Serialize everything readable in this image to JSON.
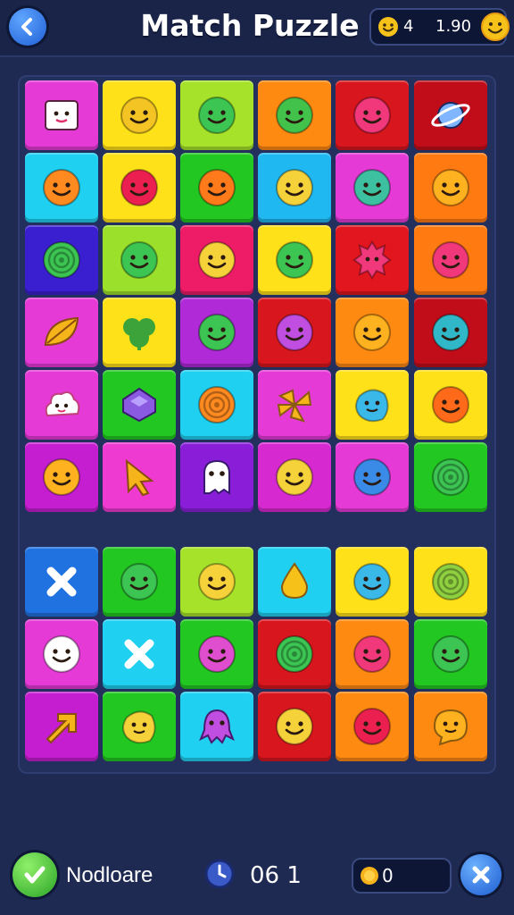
{
  "header": {
    "title": "Match Puzzle",
    "moves": "4",
    "score": "1.90"
  },
  "footer": {
    "label": "Nodloare",
    "timer": "06 1",
    "coins": "0"
  },
  "board": {
    "top_rows": [
      [
        {
          "bg": "#e53ad6",
          "icon": "square-face-icon",
          "fg": "#ffffff"
        },
        {
          "bg": "#ffe11a",
          "icon": "smiley-face-icon",
          "fg": "#f4c424"
        },
        {
          "bg": "#a6e22a",
          "icon": "smiley-face-icon",
          "fg": "#3cc552"
        },
        {
          "bg": "#ff8a12",
          "icon": "smiley-face-icon",
          "fg": "#42c24a"
        },
        {
          "bg": "#d8161e",
          "icon": "smiley-face-icon",
          "fg": "#f0387a"
        },
        {
          "bg": "#c10d1a",
          "icon": "planet-icon",
          "fg": "#7fb6ff"
        }
      ],
      [
        {
          "bg": "#1fd0f0",
          "icon": "smiley-face-icon",
          "fg": "#ff8a1f"
        },
        {
          "bg": "#ffe11a",
          "icon": "smiley-face-icon",
          "fg": "#ec2050"
        },
        {
          "bg": "#22c722",
          "icon": "smiley-face-icon",
          "fg": "#ff7a1a"
        },
        {
          "bg": "#1fb8f0",
          "icon": "smiley-face-icon",
          "fg": "#f6d23a"
        },
        {
          "bg": "#e53ad6",
          "icon": "smiley-face-icon",
          "fg": "#3cc0a0"
        },
        {
          "bg": "#ff7a10",
          "icon": "smiley-face-icon",
          "fg": "#ffb21f"
        }
      ],
      [
        {
          "bg": "#3a1fd0",
          "icon": "spiral-icon",
          "fg": "#3cc552"
        },
        {
          "bg": "#9be02a",
          "icon": "smiley-face-icon",
          "fg": "#3cc552"
        },
        {
          "bg": "#ee1c66",
          "icon": "smiley-face-icon",
          "fg": "#f6d23a"
        },
        {
          "bg": "#ffe11a",
          "icon": "smiley-face-icon",
          "fg": "#3cc552"
        },
        {
          "bg": "#e1161e",
          "icon": "spiky-monster-icon",
          "fg": "#f0387a"
        },
        {
          "bg": "#ff7a10",
          "icon": "smiley-face-icon",
          "fg": "#f0387a"
        }
      ],
      [
        {
          "bg": "#e53ad6",
          "icon": "leaf-icon",
          "fg": "#f4b41a"
        },
        {
          "bg": "#ffe11a",
          "icon": "clover-icon",
          "fg": "#3ca23a"
        },
        {
          "bg": "#b02ad8",
          "icon": "smiley-face-icon",
          "fg": "#3cc552"
        },
        {
          "bg": "#d8161e",
          "icon": "smiley-face-icon",
          "fg": "#c04ee0"
        },
        {
          "bg": "#ff8a12",
          "icon": "smiley-face-icon",
          "fg": "#ffb21f"
        },
        {
          "bg": "#c10d1a",
          "icon": "smiley-face-icon",
          "fg": "#30b8c8"
        }
      ],
      [
        {
          "bg": "#e53ad6",
          "icon": "cloud-face-icon",
          "fg": "#ffffff"
        },
        {
          "bg": "#22c722",
          "icon": "gem-icon",
          "fg": "#8a5ae0"
        },
        {
          "bg": "#1fd0f0",
          "icon": "spiral-icon",
          "fg": "#ff8a1f"
        },
        {
          "bg": "#e53ad6",
          "icon": "pinwheel-icon",
          "fg": "#f4b41a"
        },
        {
          "bg": "#ffe11a",
          "icon": "blob-face-icon",
          "fg": "#3ab8e8"
        },
        {
          "bg": "#ffe11a",
          "icon": "smiley-face-icon",
          "fg": "#ff6a1a"
        }
      ],
      [
        {
          "bg": "#c41ed0",
          "icon": "smiley-face-icon",
          "fg": "#ffb21f"
        },
        {
          "bg": "#ee3ad0",
          "icon": "cursor-arrow-icon",
          "fg": "#f4b41a"
        },
        {
          "bg": "#8a1ed8",
          "icon": "ghost-icon",
          "fg": "#ffffff"
        },
        {
          "bg": "#d62ad0",
          "icon": "smiley-face-icon",
          "fg": "#f6d23a"
        },
        {
          "bg": "#e53ad6",
          "icon": "smiley-face-icon",
          "fg": "#3a8ae8"
        },
        {
          "bg": "#22c722",
          "icon": "spiral-icon",
          "fg": "#3cc552"
        }
      ]
    ],
    "bottom_rows": [
      [
        {
          "bg": "#1f72e0",
          "icon": "cross-icon",
          "fg": "#ffffff"
        },
        {
          "bg": "#22c722",
          "icon": "smiley-face-icon",
          "fg": "#3cc552"
        },
        {
          "bg": "#a6e22a",
          "icon": "smiley-face-icon",
          "fg": "#f6d23a"
        },
        {
          "bg": "#1fd0f0",
          "icon": "droplet-icon",
          "fg": "#f6c21a"
        },
        {
          "bg": "#ffe11a",
          "icon": "smiley-face-icon",
          "fg": "#3ab8e8"
        },
        {
          "bg": "#ffe11a",
          "icon": "spiral-icon",
          "fg": "#8fd040"
        }
      ],
      [
        {
          "bg": "#e53ad6",
          "icon": "smiley-face-icon",
          "fg": "#ffffff"
        },
        {
          "bg": "#1fd0f0",
          "icon": "cross-icon",
          "fg": "#ffffff"
        },
        {
          "bg": "#22c722",
          "icon": "smiley-face-icon",
          "fg": "#e04ed0"
        },
        {
          "bg": "#d8161e",
          "icon": "spiral-icon",
          "fg": "#3cc552"
        },
        {
          "bg": "#ff8a12",
          "icon": "smiley-face-icon",
          "fg": "#f0387a"
        },
        {
          "bg": "#22c722",
          "icon": "smiley-face-icon",
          "fg": "#3cc552"
        }
      ],
      [
        {
          "bg": "#c41ed0",
          "icon": "arrow-icon",
          "fg": "#f4b41a"
        },
        {
          "bg": "#22c722",
          "icon": "blob-face-icon",
          "fg": "#f6d23a"
        },
        {
          "bg": "#1fd0f0",
          "icon": "octopus-icon",
          "fg": "#c04ee0"
        },
        {
          "bg": "#d8161e",
          "icon": "smiley-face-icon",
          "fg": "#f6d23a"
        },
        {
          "bg": "#ff8a12",
          "icon": "smiley-face-icon",
          "fg": "#ec2050"
        },
        {
          "bg": "#ff8a12",
          "icon": "chat-face-icon",
          "fg": "#ffb21f"
        }
      ]
    ]
  }
}
